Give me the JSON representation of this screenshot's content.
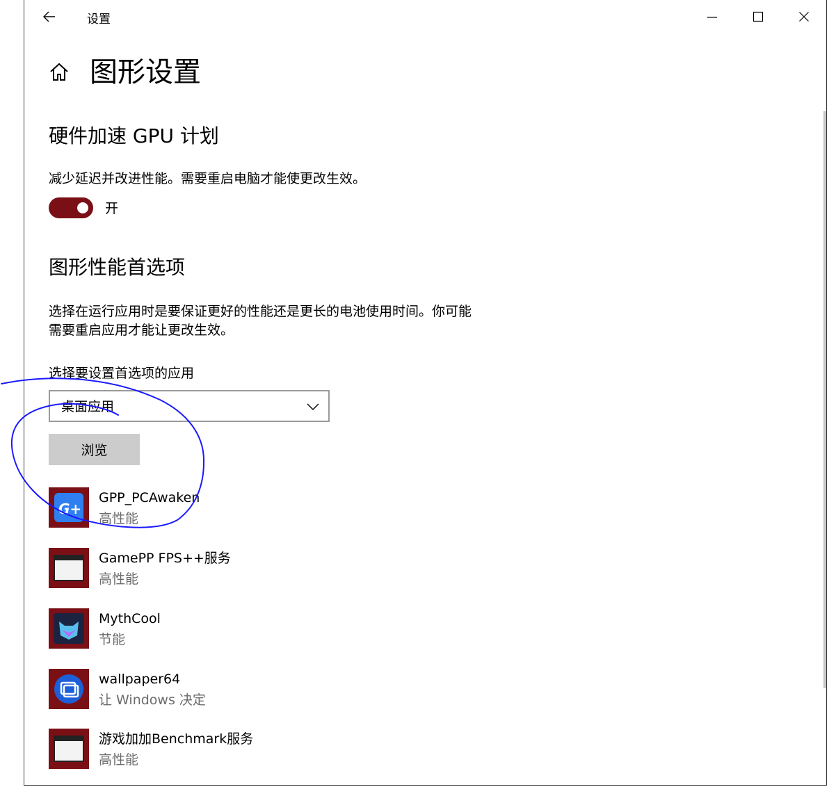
{
  "window": {
    "title": "设置",
    "controls": {
      "minimize": "minimize",
      "maximize": "maximize",
      "close": "close"
    }
  },
  "page": {
    "title": "图形设置"
  },
  "gpu_section": {
    "heading": "硬件加速 GPU 计划",
    "description": "减少延迟并改进性能。需要重启电脑才能使更改生效。",
    "toggle": {
      "state": "on",
      "label": "开",
      "color": "#7a1016"
    }
  },
  "perf_section": {
    "heading": "图形性能首选项",
    "description_line1": "选择在运行应用时是要保证更好的性能还是更长的电池使用时间。你可能",
    "description_line2": "需要重启应用才能让更改生效。",
    "select_label": "选择要设置首选项的应用",
    "select_value": "桌面应用",
    "browse_label": "浏览"
  },
  "apps": [
    {
      "name": "GPP_PCAwaken",
      "preference": "高性能",
      "icon": "gamepp-awaken-icon"
    },
    {
      "name": "GamePP FPS++服务",
      "preference": "高性能",
      "icon": "generic-window-icon"
    },
    {
      "name": "MythCool",
      "preference": "节能",
      "icon": "mythcool-icon"
    },
    {
      "name": "wallpaper64",
      "preference": "让 Windows 决定",
      "icon": "wallpaper-engine-icon"
    },
    {
      "name": "游戏加加Benchmark服务",
      "preference": "高性能",
      "icon": "generic-window-icon"
    }
  ],
  "colors": {
    "accent": "#7a1016",
    "annotation_ink": "#1a1aff",
    "secondary_text": "#6b6b6b"
  }
}
